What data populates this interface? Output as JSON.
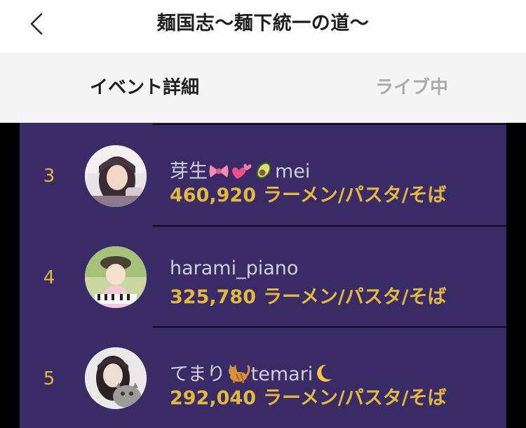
{
  "header": {
    "title": "麺国志〜麺下統一の道〜",
    "back_icon": "chevron-left-icon"
  },
  "tabs": [
    {
      "label": "イベント詳細",
      "active": true
    },
    {
      "label": "ライブ中",
      "active": false
    }
  ],
  "ranking": [
    {
      "rank": "3",
      "name_prefix": "芽生",
      "name_suffix": "mei",
      "name_emojis": [
        "ribbon-icon",
        "two-hearts-icon",
        "avocado-icon"
      ],
      "score": "460,920",
      "unit": "ラーメン/パスタ/そば"
    },
    {
      "rank": "4",
      "name_prefix": "harami_piano",
      "name_suffix": "",
      "name_emojis": [],
      "score": "325,780",
      "unit": "ラーメン/パスタ/そば"
    },
    {
      "rank": "5",
      "name_prefix": "てまり",
      "name_suffix": "temari",
      "name_emojis": [
        "cat-icon",
        "crescent-moon-icon"
      ],
      "score": "292,040",
      "unit": "ラーメン/パスタ/そば"
    }
  ],
  "colors": {
    "panel": "#3a2b66",
    "accent_gold": "#e2b93f",
    "name_text": "#cfcfd6",
    "tab_inactive": "#ababab"
  }
}
